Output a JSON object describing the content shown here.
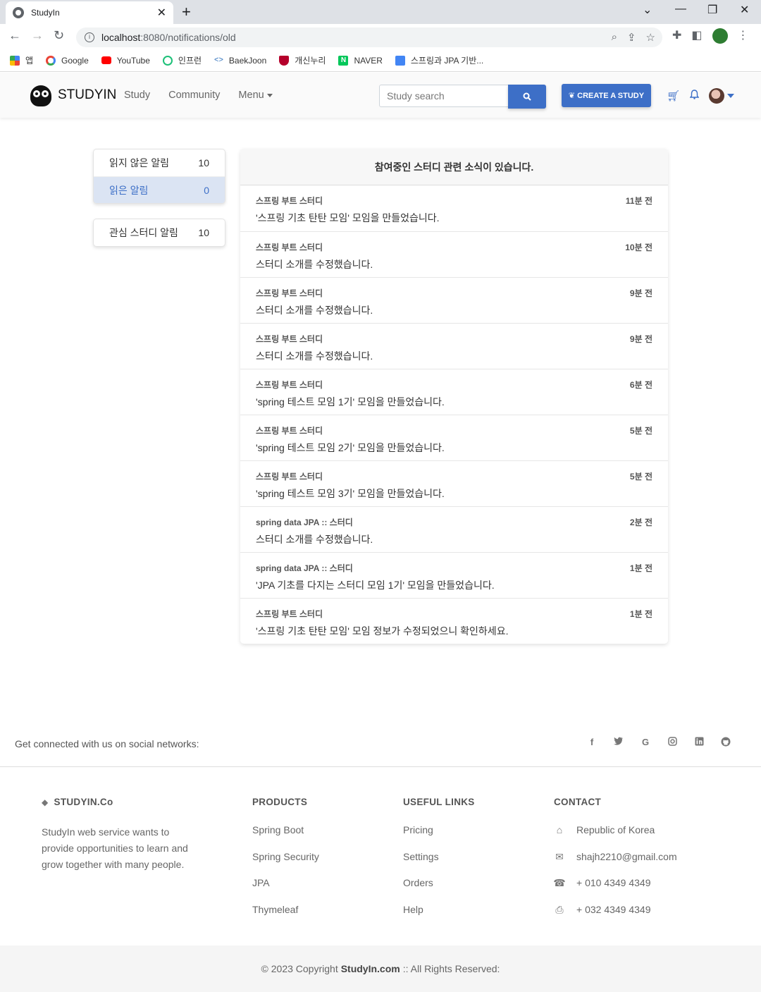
{
  "browser": {
    "tab_title": "StudyIn",
    "url_host": "localhost",
    "url_path": ":8080/notifications/old",
    "bookmarks": [
      {
        "label": "앱",
        "color": "#4285f4"
      },
      {
        "label": "Google",
        "color": "#ea4335"
      },
      {
        "label": "YouTube",
        "color": "#ff0000"
      },
      {
        "label": "인프런",
        "color": "#1dc078"
      },
      {
        "label": "BaekJoon",
        "color": "#2a6ebb"
      },
      {
        "label": "개신누리",
        "color": "#b5002b"
      },
      {
        "label": "NAVER",
        "color": "#03c75a"
      },
      {
        "label": "스프링과 JPA 기반...",
        "color": "#4285f4"
      }
    ]
  },
  "nav": {
    "brand": "STUDYIN",
    "links": [
      "Study",
      "Community",
      "Menu"
    ],
    "search_placeholder": "Study search",
    "create_label": "CREATE A STUDY",
    "accent": "#3d6fc7"
  },
  "sidebar": {
    "group1": [
      {
        "label": "읽지 않은 알림",
        "count": "10",
        "active": false
      },
      {
        "label": "읽은 알림",
        "count": "0",
        "active": true
      }
    ],
    "group2": [
      {
        "label": "관심 스터디 알림",
        "count": "10"
      }
    ]
  },
  "notifications": {
    "header": "참여중인 스터디 관련 소식이 있습니다.",
    "items": [
      {
        "study": "스프링 부트 스터디",
        "time": "11분 전",
        "message": "'스프링 기초 탄탄 모임' 모임을 만들었습니다."
      },
      {
        "study": "스프링 부트 스터디",
        "time": "10분 전",
        "message": "스터디 소개를 수정했습니다."
      },
      {
        "study": "스프링 부트 스터디",
        "time": "9분 전",
        "message": "스터디 소개를 수정했습니다."
      },
      {
        "study": "스프링 부트 스터디",
        "time": "9분 전",
        "message": "스터디 소개를 수정했습니다."
      },
      {
        "study": "스프링 부트 스터디",
        "time": "6분 전",
        "message": "'spring 테스트 모임 1기' 모임을 만들었습니다."
      },
      {
        "study": "스프링 부트 스터디",
        "time": "5분 전",
        "message": "'spring 테스트 모임 2기' 모임을 만들었습니다."
      },
      {
        "study": "스프링 부트 스터디",
        "time": "5분 전",
        "message": "'spring 테스트 모임 3기' 모임을 만들었습니다."
      },
      {
        "study": "spring data JPA :: 스터디",
        "time": "2분 전",
        "message": "스터디 소개를 수정했습니다."
      },
      {
        "study": "spring data JPA :: 스터디",
        "time": "1분 전",
        "message": "'JPA 기초를 다지는 스터디 모임 1기' 모임을 만들었습니다."
      },
      {
        "study": "스프링 부트 스터디",
        "time": "1분 전",
        "message": "'스프링 기초 탄탄 모임' 모임 정보가 수정되었으니 확인하세요."
      }
    ]
  },
  "footer": {
    "social_text": "Get connected with us on social networks:",
    "social_icons": [
      "facebook-icon",
      "twitter-icon",
      "google-icon",
      "instagram-icon",
      "linkedin-icon",
      "github-icon"
    ],
    "company": {
      "title": "STUDYIN.Co",
      "desc": "StudyIn web service wants to provide opportunities to learn and grow together with many people."
    },
    "products": {
      "title": "PRODUCTS",
      "links": [
        "Spring Boot",
        "Spring Security",
        "JPA",
        "Thymeleaf"
      ]
    },
    "useful": {
      "title": "USEFUL LINKS",
      "links": [
        "Pricing",
        "Settings",
        "Orders",
        "Help"
      ]
    },
    "contact": {
      "title": "CONTACT",
      "items": [
        {
          "icon": "home-icon",
          "text": "Republic of Korea"
        },
        {
          "icon": "envelope-icon",
          "text": "shajh2210@gmail.com"
        },
        {
          "icon": "phone-icon",
          "text": "+ 010 4349 4349"
        },
        {
          "icon": "print-icon",
          "text": "+ 032 4349 4349"
        }
      ]
    },
    "copyright_pre": "© 2023 Copyright",
    "copyright_brand": "StudyIn.com",
    "copyright_post": ":: All Rights Reserved:"
  }
}
